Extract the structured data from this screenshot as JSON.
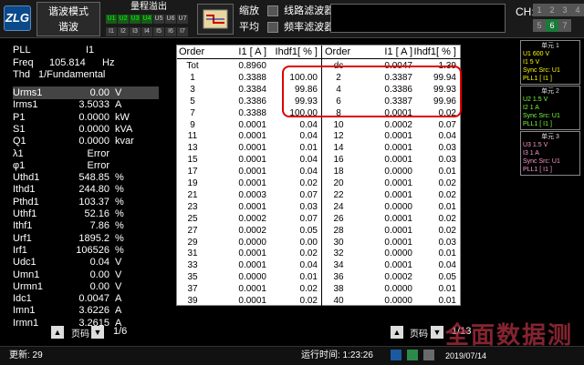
{
  "top": {
    "mode_line1": "谐波模式",
    "mode_line2": "谐波",
    "range_title": "量程溢出",
    "range_row1": [
      "U1",
      "U2",
      "U3",
      "U4",
      "U5",
      "U6",
      "U7"
    ],
    "range_row2": [
      "I1",
      "I2",
      "I3",
      "I4",
      "I5",
      "I6",
      "I7"
    ],
    "filter1_label": "缩放",
    "filter1_name": "线路滤波器",
    "filter2_label": "平均",
    "filter2_name": "频率滤波器",
    "ch_label": "CH:",
    "ch_buttons": [
      "1",
      "2",
      "3",
      "4",
      "5",
      "6",
      "7"
    ]
  },
  "left": {
    "pll_label": "PLL",
    "pll_value": "I1",
    "freq_label": "Freq",
    "freq_value": "105.814",
    "freq_unit": "Hz",
    "thd_label": "Thd",
    "thd_value": "1/Fundamental",
    "rows": [
      {
        "n": "Urms1",
        "v": "0.00",
        "u": "V"
      },
      {
        "n": "Irms1",
        "v": "3.5033",
        "u": "A"
      },
      {
        "n": "P1",
        "v": "0.0000",
        "u": "kW"
      },
      {
        "n": "S1",
        "v": "0.0000",
        "u": "kVA"
      },
      {
        "n": "Q1",
        "v": "0.0000",
        "u": "kvar"
      },
      {
        "n": "λ1",
        "v": "Error",
        "u": ""
      },
      {
        "n": "φ1",
        "v": "Error",
        "u": ""
      },
      {
        "n": "Uthd1",
        "v": "548.85",
        "u": "%"
      },
      {
        "n": "Ithd1",
        "v": "244.80",
        "u": "%"
      },
      {
        "n": "Pthd1",
        "v": "103.37",
        "u": "%"
      },
      {
        "n": "Uthf1",
        "v": "52.16",
        "u": "%"
      },
      {
        "n": "Ithf1",
        "v": "7.86",
        "u": "%"
      },
      {
        "n": "Urf1",
        "v": "1895.2",
        "u": "%"
      },
      {
        "n": "Irf1",
        "v": "106526",
        "u": "%"
      },
      {
        "n": "Udc1",
        "v": "0.04",
        "u": "V"
      },
      {
        "n": "Umn1",
        "v": "0.00",
        "u": "V"
      },
      {
        "n": "Urmn1",
        "v": "0.00",
        "u": "V"
      },
      {
        "n": "Idc1",
        "v": "0.0047",
        "u": "A"
      },
      {
        "n": "Imn1",
        "v": "3.6226",
        "u": "A"
      },
      {
        "n": "Irmn1",
        "v": "3.2615",
        "u": "A"
      }
    ],
    "page_label": "页码",
    "page_value": "1/6"
  },
  "table": {
    "headers": [
      "Order",
      "I1 [ A ]",
      "Ihdf1[ % ]",
      "Order",
      "I1 [ A ]",
      "Ihdf1[ % ]"
    ],
    "rows": [
      [
        "Tot",
        "0.8960",
        "",
        "dc",
        "0.0047",
        "1.39"
      ],
      [
        "1",
        "0.3388",
        "100.00",
        "2",
        "0.3387",
        "99.94"
      ],
      [
        "3",
        "0.3384",
        "99.86",
        "4",
        "0.3386",
        "99.93"
      ],
      [
        "5",
        "0.3386",
        "99.93",
        "6",
        "0.3387",
        "99.96"
      ],
      [
        "7",
        "0.3388",
        "100.00",
        "8",
        "0.0001",
        "0.02"
      ],
      [
        "9",
        "0.0001",
        "0.04",
        "10",
        "0.0002",
        "0.07"
      ],
      [
        "11",
        "0.0001",
        "0.04",
        "12",
        "0.0001",
        "0.04"
      ],
      [
        "13",
        "0.0001",
        "0.01",
        "14",
        "0.0001",
        "0.03"
      ],
      [
        "15",
        "0.0001",
        "0.04",
        "16",
        "0.0001",
        "0.03"
      ],
      [
        "17",
        "0.0001",
        "0.04",
        "18",
        "0.0000",
        "0.01"
      ],
      [
        "19",
        "0.0001",
        "0.02",
        "20",
        "0.0001",
        "0.02"
      ],
      [
        "21",
        "0.0003",
        "0.07",
        "22",
        "0.0001",
        "0.02"
      ],
      [
        "23",
        "0.0001",
        "0.03",
        "24",
        "0.0000",
        "0.01"
      ],
      [
        "25",
        "0.0002",
        "0.07",
        "26",
        "0.0001",
        "0.02"
      ],
      [
        "27",
        "0.0002",
        "0.05",
        "28",
        "0.0001",
        "0.02"
      ],
      [
        "29",
        "0.0000",
        "0.00",
        "30",
        "0.0001",
        "0.03"
      ],
      [
        "31",
        "0.0001",
        "0.02",
        "32",
        "0.0000",
        "0.01"
      ],
      [
        "33",
        "0.0001",
        "0.04",
        "34",
        "0.0001",
        "0.04"
      ],
      [
        "35",
        "0.0000",
        "0.01",
        "36",
        "0.0002",
        "0.05"
      ],
      [
        "37",
        "0.0001",
        "0.02",
        "38",
        "0.0000",
        "0.01"
      ],
      [
        "39",
        "0.0001",
        "0.02",
        "40",
        "0.0000",
        "0.01"
      ]
    ],
    "page_label": "页码",
    "page_value": "1/13"
  },
  "units": [
    {
      "title": "单元 1",
      "l1": "U1   600 V",
      "l2": "I1      5 V",
      "l3": "Sync Src: U1",
      "l4": "PLL1 [ I1 ]",
      "color": "#ffff00"
    },
    {
      "title": "单元 2",
      "l1": "U2   1.5 V",
      "l2": "I2      1 A",
      "l3": "Sync Src: U1",
      "l4": "PLL1 [ I1 ]",
      "color": "#7fff3f"
    },
    {
      "title": "单元 3",
      "l1": "U3   1.5 V",
      "l2": "I3      1 A",
      "l3": "Sync Src: U1",
      "l4": "PLL1 [ I1 ]",
      "color": "#ff9acb"
    }
  ],
  "bottom": {
    "update_label": "更新: 29",
    "runtime_label": "运行时间: 1:23:26",
    "date": "2019/07/14"
  },
  "watermark": {
    "text": "全面数据测"
  }
}
